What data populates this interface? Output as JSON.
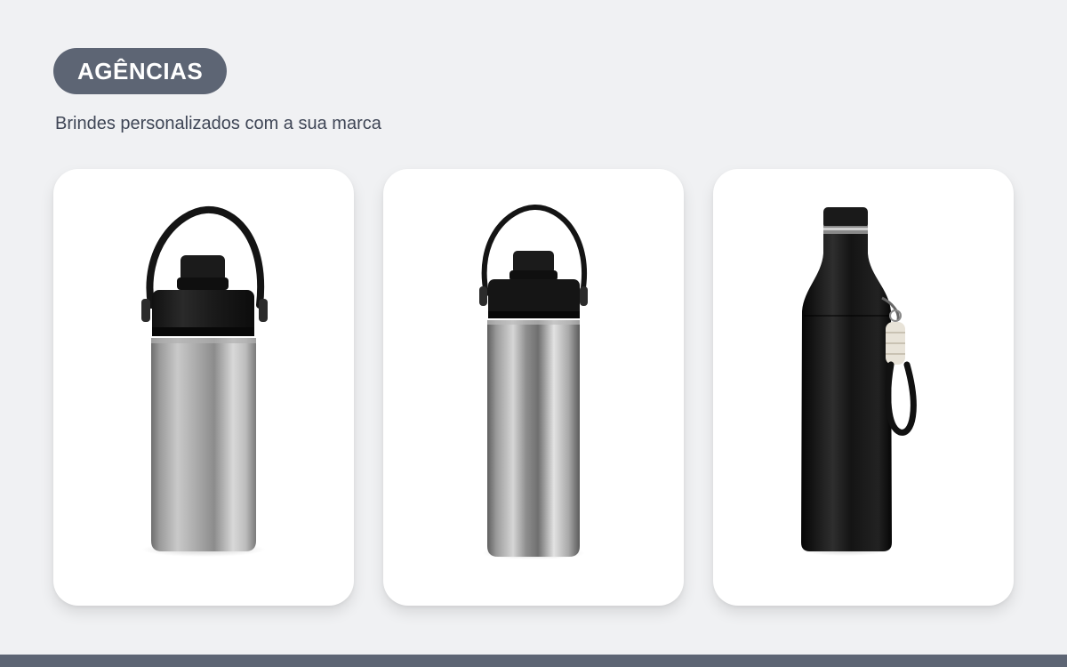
{
  "header": {
    "badge_label": "AGÊNCIAS",
    "subtitle": "Brindes personalizados com a sua marca"
  },
  "products": [
    {
      "image": "stainless-steel-bottle-with-handle-lid"
    },
    {
      "image": "stainless-steel-slim-bottle-with-handle-lid"
    },
    {
      "image": "black-bottle-with-cord-strap"
    }
  ],
  "colors": {
    "background": "#f0f1f3",
    "badge": "#5d6574",
    "subtitle_text": "#3f4656",
    "card": "#ffffff",
    "footer_bar": "#5d6574"
  }
}
